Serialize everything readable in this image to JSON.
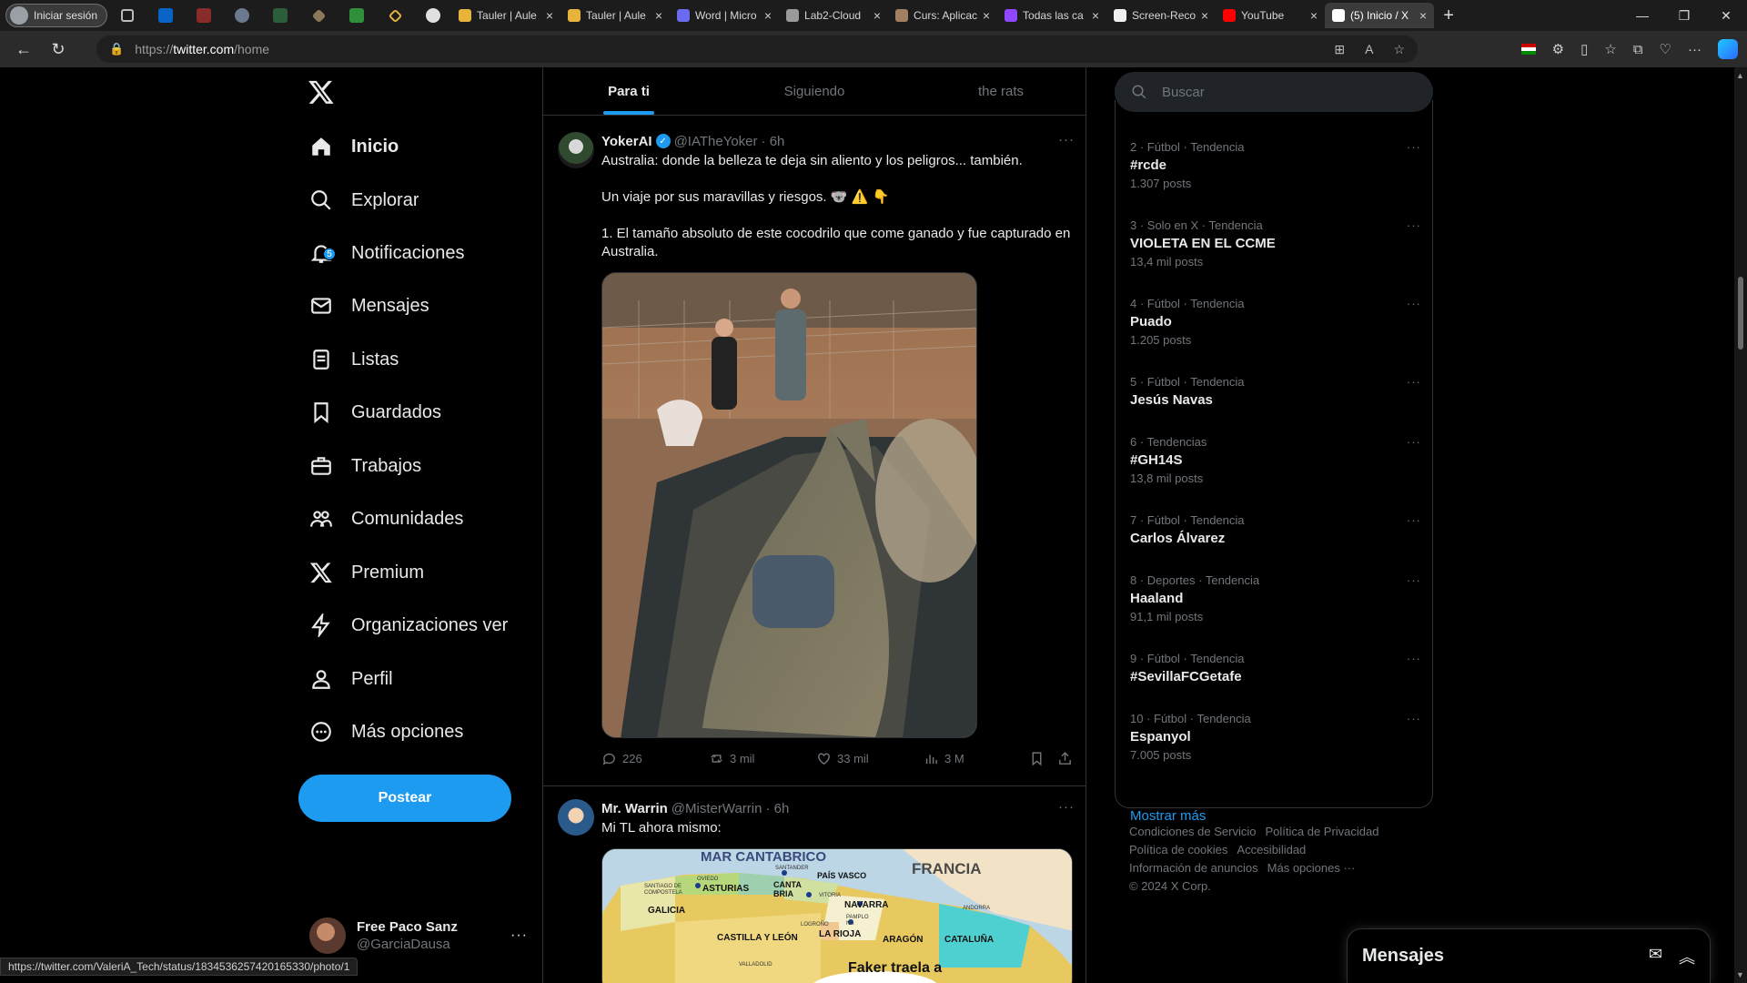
{
  "browser": {
    "profile_label": "Iniciar sesión",
    "tabs": [
      {
        "label": "Tauler | Aule",
        "fav": "#e8b33a"
      },
      {
        "label": "Tauler | Aule",
        "fav": "#e8b33a"
      },
      {
        "label": "Word | Micro",
        "fav": "#6b6bf0"
      },
      {
        "label": "Lab2-Cloud",
        "fav": "#9a9a9a"
      },
      {
        "label": "Curs: Aplicac",
        "fav": "#a08060"
      },
      {
        "label": "Todas las ca",
        "fav": "#9146ff"
      },
      {
        "label": "Screen-Reco",
        "fav": "#f0f0f0"
      },
      {
        "label": "YouTube",
        "fav": "#ff0000"
      },
      {
        "label": "(5) Inicio / X",
        "fav": "#ffffff"
      }
    ],
    "url_scheme": "https://",
    "url_host": "twitter.com",
    "url_path": "/home",
    "status_url": "https://twitter.com/ValeriA_Tech/status/1834536257420165330/photo/1"
  },
  "nav": {
    "items": [
      {
        "label": "Inicio",
        "icon": "home-icon"
      },
      {
        "label": "Explorar",
        "icon": "search-icon"
      },
      {
        "label": "Notificaciones",
        "icon": "bell-icon",
        "badge": "5"
      },
      {
        "label": "Mensajes",
        "icon": "mail-icon"
      },
      {
        "label": "Listas",
        "icon": "list-icon"
      },
      {
        "label": "Guardados",
        "icon": "bookmark-icon"
      },
      {
        "label": "Trabajos",
        "icon": "briefcase-icon"
      },
      {
        "label": "Comunidades",
        "icon": "people-icon"
      },
      {
        "label": "Premium",
        "icon": "x-icon"
      },
      {
        "label": "Organizaciones ver",
        "icon": "bolt-icon"
      },
      {
        "label": "Perfil",
        "icon": "person-icon"
      },
      {
        "label": "Más opciones",
        "icon": "more-circle-icon"
      }
    ],
    "post_label": "Postear",
    "account": {
      "display_name": "Free Paco Sanz",
      "handle": "@GarciaDausa"
    }
  },
  "timeline": {
    "tabs": [
      "Para ti",
      "Siguiendo",
      "the rats"
    ],
    "tweets": [
      {
        "name": "YokerAI",
        "handle": "@IATheYoker",
        "time": "· 6h",
        "text": "Australia: donde la belleza te deja sin aliento y los peligros... también.\n\nUn viaje por sus maravillas y riesgos. 🐨 ⚠️ 👇\n\n1. El tamaño absoluto de este cocodrilo que come ganado y fue capturado en Australia.",
        "replies": "226",
        "reposts": "3 mil",
        "likes": "33 mil",
        "views": "3 M"
      },
      {
        "name": "Mr. Warrin",
        "handle": "@MisterWarrin",
        "time": "· 6h",
        "text": "Mi TL ahora mismo:",
        "map_labels": {
          "sea": "MAR CANTABRICO",
          "country": "FRANCIA",
          "regions": [
            "ASTURIAS",
            "CANTA BRIA",
            "PAÍS VASCO",
            "GALICIA",
            "NAVARRA",
            "CASTILLA Y LEÓN",
            "LA RIOJA",
            "ARAGÓN",
            "CATALUÑA"
          ],
          "cities": [
            "SANTIAGO DE COMPOSTELA",
            "OVIEDO",
            "SANTANDER",
            "VITORIA",
            "LOGROÑO",
            "PAMPLO NA",
            "ANDORRA",
            "VALLADOLID"
          ],
          "caption": "Faker traela a"
        }
      }
    ]
  },
  "sidebar": {
    "search_placeholder": "Buscar",
    "trends": [
      {
        "meta": "2 · Fútbol · Tendencia",
        "topic": "#rcde",
        "count": "1.307 posts"
      },
      {
        "meta": "3 · Solo en X · Tendencia",
        "topic": "VIOLETA EN EL CCME",
        "count": "13,4 mil posts"
      },
      {
        "meta": "4 · Fútbol · Tendencia",
        "topic": "Puado",
        "count": "1.205 posts"
      },
      {
        "meta": "5 · Fútbol · Tendencia",
        "topic": "Jesús Navas",
        "count": ""
      },
      {
        "meta": "6 · Tendencias",
        "topic": "#GH14S",
        "count": "13,8 mil posts"
      },
      {
        "meta": "7 · Fútbol · Tendencia",
        "topic": "Carlos Álvarez",
        "count": ""
      },
      {
        "meta": "8 · Deportes · Tendencia",
        "topic": "Haaland",
        "count": "91,1 mil posts"
      },
      {
        "meta": "9 · Fútbol · Tendencia",
        "topic": "#SevillaFCGetafe",
        "count": ""
      },
      {
        "meta": "10 · Fútbol · Tendencia",
        "topic": "Espanyol",
        "count": "7.005 posts"
      }
    ],
    "show_more": "Mostrar más",
    "footer": {
      "links": [
        "Condiciones de Servicio",
        "Política de Privacidad",
        "Política de cookies",
        "Accesibilidad",
        "Información de anuncios",
        "Más opciones ···"
      ],
      "copyright": "© 2024 X Corp."
    }
  },
  "dm_drawer": {
    "title": "Mensajes"
  },
  "colors": {
    "accent": "#1d9bf0",
    "bg": "#000000",
    "border": "#2f3336",
    "muted": "#71767b"
  }
}
